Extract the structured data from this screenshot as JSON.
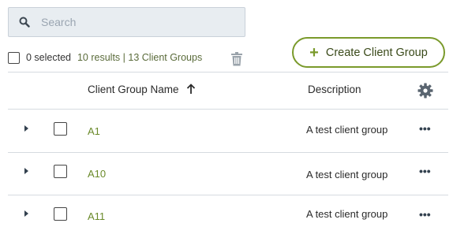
{
  "search": {
    "placeholder": "Search",
    "icon": "search-icon"
  },
  "selection": {
    "selected_label": "0 selected",
    "results": "10 results",
    "separator": "|",
    "total": "13 Client Groups"
  },
  "toolbar": {
    "create_label": "Create Client Group",
    "create_icon": "plus-icon",
    "delete_icon": "trash-icon"
  },
  "table": {
    "columns": {
      "name": "Client Group Name",
      "description": "Description"
    },
    "sort": "ascending",
    "rows": [
      {
        "name": "A1",
        "description": "A test client group"
      },
      {
        "name": "A10",
        "description": "A test client group"
      },
      {
        "name": "A11",
        "description": "A test client group"
      }
    ]
  },
  "colors": {
    "accent": "#7a9a2b",
    "link": "#6a8a2a",
    "search_bg": "#e8edf1",
    "divider": "#d6dbe0"
  }
}
